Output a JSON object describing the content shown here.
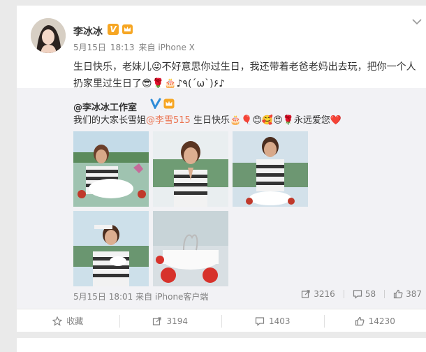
{
  "post": {
    "username": "李冰冰",
    "verified_icon": "v-badge-icon",
    "badge_icon": "crown-icon",
    "date": "5月15日",
    "time": "18:13",
    "source": "来自 iPhone X",
    "text": "生日快乐，老妹儿😜不好意思你过生日，我还带着老爸老妈出去玩，把你一个人扔家里过生日了😎🌹🎂♪٩(´ω`)۶♪"
  },
  "repost": {
    "username": "@李冰冰工作室",
    "text_prefix": "我们的大家长雪姐",
    "mention": "@李雪515",
    "text_suffix": " 生日快乐🎂🎈😊🥰😍🌹永远爱您❤️",
    "meta": "5月15日 18:01 来自 iPhone客户端",
    "reposts": "3216",
    "comments": "58",
    "likes": "387",
    "photo_count": 5
  },
  "actions": {
    "favorite_label": "收藏",
    "repost_count": "3194",
    "comment_count": "1403",
    "like_count": "14230"
  },
  "colors": {
    "mention": "#eb7350",
    "badge": "#f6a623",
    "verified_blue": "#2e8cd8"
  }
}
